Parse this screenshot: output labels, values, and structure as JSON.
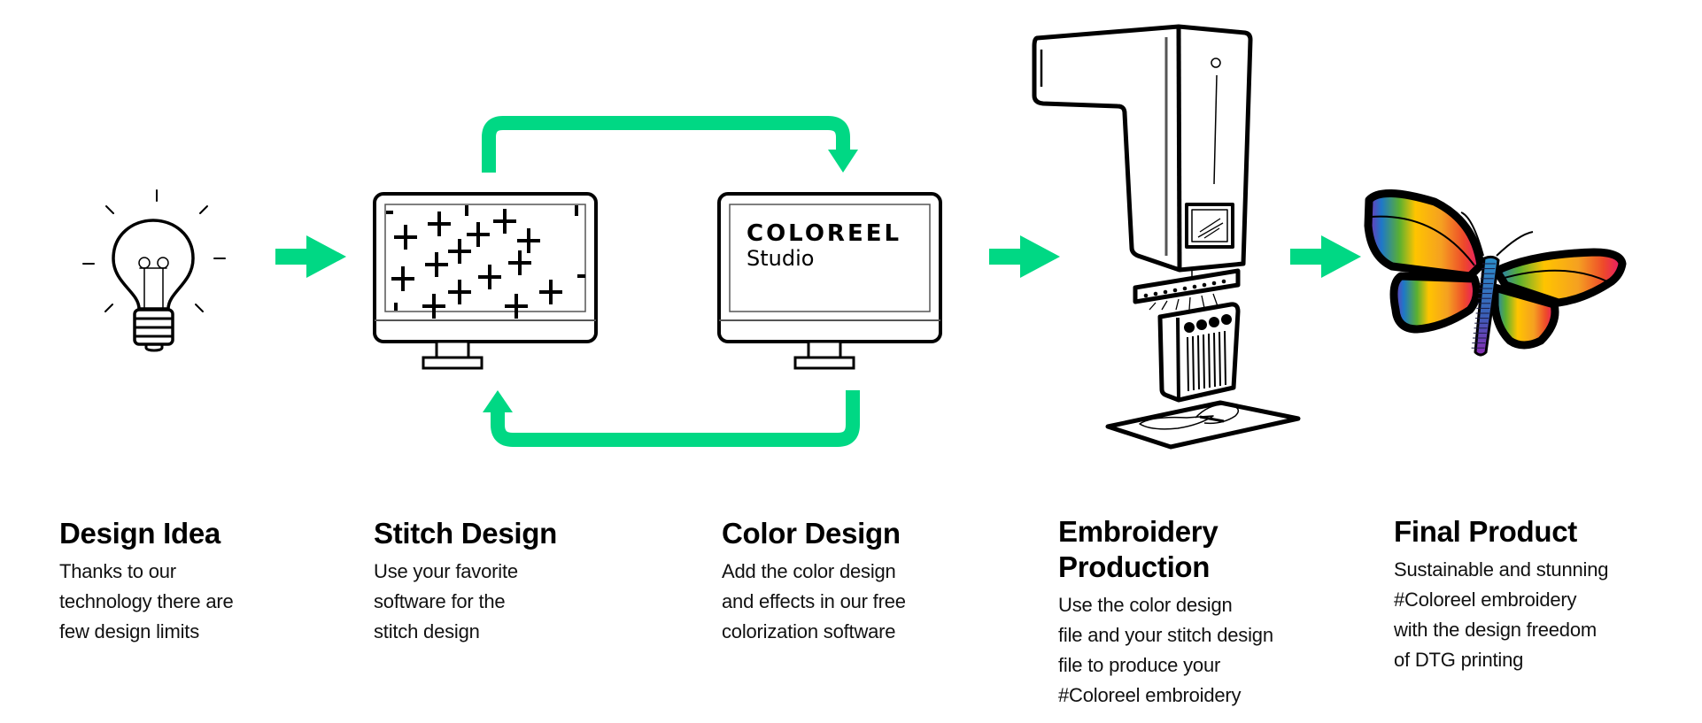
{
  "colors": {
    "accent": "#00D884",
    "ink": "#000000",
    "wing_gradient": [
      "#7A2FB8",
      "#1E78C8",
      "#5BB030",
      "#FFC400",
      "#F5A021",
      "#EE4A2A",
      "#E8156E"
    ]
  },
  "software_screen": {
    "brand": "COLOREEL",
    "product": "Studio"
  },
  "steps": [
    {
      "id": "design-idea",
      "icon": "lightbulb-icon",
      "title": "Design Idea",
      "lines": [
        "Thanks to our",
        "technology there are",
        "few design limits"
      ]
    },
    {
      "id": "stitch-design",
      "icon": "stitch-monitor-icon",
      "title": "Stitch Design",
      "lines": [
        "Use your favorite",
        "software for the",
        "stitch design"
      ]
    },
    {
      "id": "color-design",
      "icon": "coloreel-studio-monitor-icon",
      "title": "Color Design",
      "lines": [
        "Add the color design",
        "and effects in our free",
        "colorization software"
      ]
    },
    {
      "id": "embroidery-production",
      "icon": "embroidery-machine-icon",
      "title_lines": [
        "Embroidery",
        "Production"
      ],
      "lines": [
        "Use the color design",
        "file and your stitch design",
        "file to produce your",
        "#Coloreel embroidery"
      ]
    },
    {
      "id": "final-product",
      "icon": "butterfly-icon",
      "title": "Final Product",
      "lines": [
        "Sustainable and stunning",
        "#Coloreel embroidery",
        "with the design freedom",
        "of DTG printing"
      ]
    }
  ]
}
